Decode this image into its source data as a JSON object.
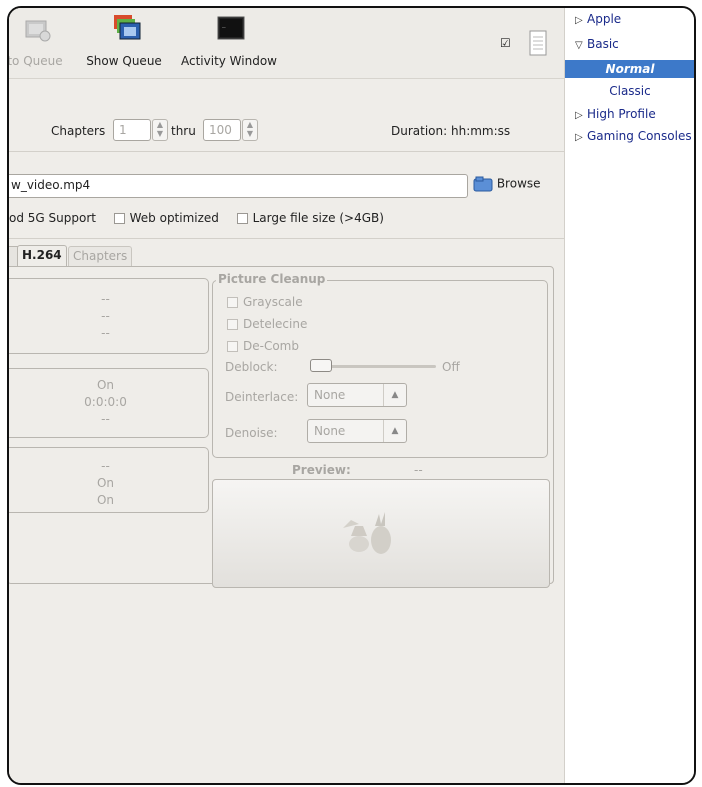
{
  "toolbar": {
    "add_queue": "to Queue",
    "show_queue": "Show Queue",
    "activity": "Activity Window"
  },
  "source": {
    "chapters_label": "Chapters",
    "chapter_start": "1",
    "thru_label": "thru",
    "chapter_end": "100",
    "duration": "Duration: hh:mm:ss"
  },
  "destination": {
    "file": "w_video.mp4",
    "browse_label": "Browse"
  },
  "options": {
    "ipod_support": "od 5G Support",
    "web_optimized": "Web optimized",
    "large_file": "Large file size (>4GB)"
  },
  "tabs": {
    "video_codec": "H.264",
    "chapters": "Chapters"
  },
  "group1": {
    "r1": "--",
    "r2": "--",
    "r3": "--"
  },
  "group2": {
    "r1": "On",
    "r2": "0:0:0:0",
    "r3": "--"
  },
  "group3": {
    "r1": "--",
    "r2": "On",
    "r3": "On"
  },
  "cleanup": {
    "title": "Picture Cleanup",
    "grayscale": "Grayscale",
    "detelecine": "Detelecine",
    "decomb": "De-Comb",
    "deblock_label": "Deblock:",
    "deblock_value": "Off",
    "deinterlace_label": "Deinterlace:",
    "deinterlace_value": "None",
    "denoise_label": "Denoise:",
    "denoise_value": "None"
  },
  "preview": {
    "label": "Preview:",
    "value": "--"
  },
  "sidebar": {
    "apple": "Apple",
    "basic": "Basic",
    "normal": "Normal",
    "classic": "Classic",
    "high_profile": "High Profile",
    "gaming": "Gaming Consoles"
  }
}
